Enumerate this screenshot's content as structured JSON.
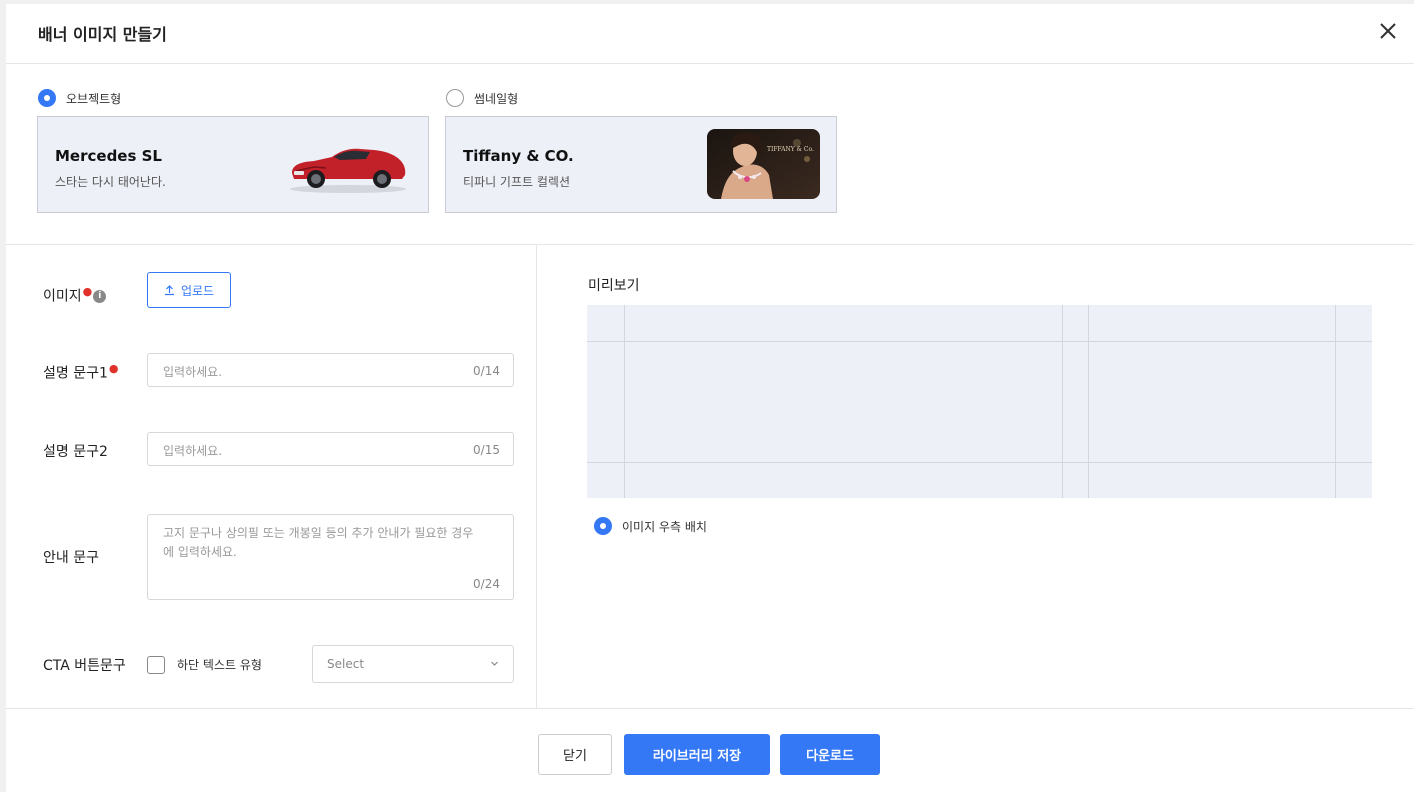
{
  "header": {
    "title": "배너 이미지 만들기"
  },
  "types": [
    {
      "label": "오브젝트형",
      "selected": true,
      "card_title": "Mercedes SL",
      "card_sub": "스타는 다시 태어난다."
    },
    {
      "label": "썸네일형",
      "selected": false,
      "card_title": "Tiffany & CO.",
      "card_sub": "티파니 기프트 컬렉션",
      "logo_text": "TIFFANY & Co."
    }
  ],
  "form": {
    "image": {
      "label": "이미지",
      "upload_label": "업로드"
    },
    "desc1": {
      "label": "설명 문구1",
      "placeholder": "입력하세요.",
      "count": "0/14"
    },
    "desc2": {
      "label": "설명 문구2",
      "placeholder": "입력하세요.",
      "count": "0/15"
    },
    "notice": {
      "label": "안내 문구",
      "placeholder": "고지 문구나 상의필 또는 개봉일 등의 추가 안내가 필요한 경우에 입력하세요.",
      "count": "0/24"
    },
    "cta": {
      "label": "CTA 버튼문구",
      "checkbox_label": "하단 텍스트 유형",
      "select_value": "Select"
    }
  },
  "preview": {
    "title": "미리보기",
    "radio_label": "이미지 우측 배치"
  },
  "footer": {
    "close": "닫기",
    "save": "라이브러리 저장",
    "download": "다운로드"
  },
  "colors": {
    "primary": "#3478f6",
    "required": "#e0312b",
    "card_bg": "#edf0f7"
  },
  "icons": {
    "close": "close-icon",
    "upload": "upload-icon",
    "info": "info-icon",
    "chevron": "chevron-down-icon"
  }
}
